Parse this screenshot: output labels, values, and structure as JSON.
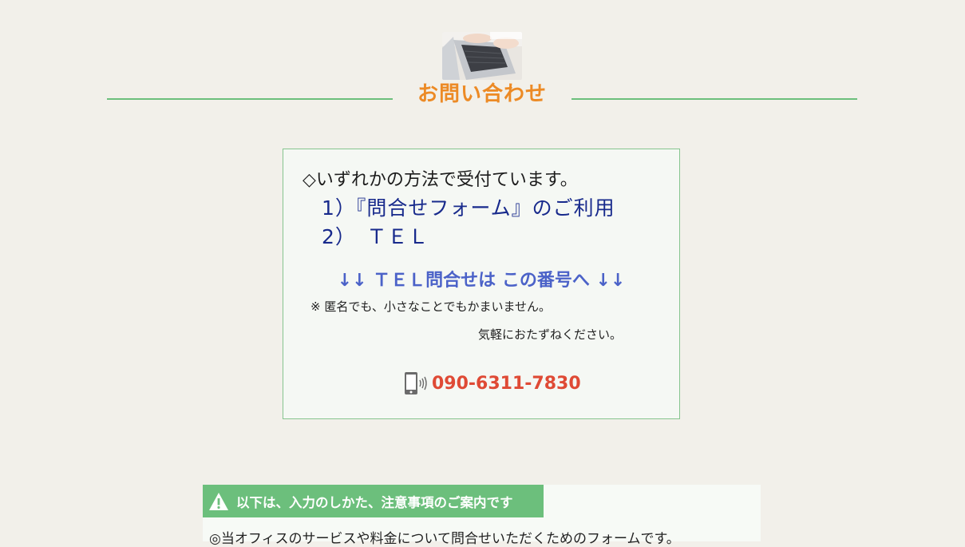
{
  "header": {
    "title": "お問い合わせ",
    "image_name": "laptop-typing-photo"
  },
  "contact_box": {
    "intro": "◇いずれかの方法で受付ています。",
    "options": [
      "1）『問合せフォーム』のご利用",
      "2）　ＴＥＬ"
    ],
    "tel_heading": "↓↓ ＴＥＬ問合せは この番号へ ↓↓",
    "note_line1": "※ 匿名でも、小さなことでもかまいません。",
    "note_line2": "気軽におたずねください。",
    "phone_icon": "smartphone-icon",
    "phone_number": "090-6311-7830"
  },
  "notice": {
    "icon": "warning-icon",
    "text": "以下は、入力のしかた、注意事項のご案内です",
    "description": "◎当オフィスのサービスや料金について問合せいただくためのフォームです。"
  },
  "colors": {
    "background": "#f2f0ea",
    "accent_orange": "#ec8a25",
    "rule_green": "#6cbf7c",
    "navy": "#182a8c",
    "tel_blue": "#4b62c8",
    "phone_red": "#df4a35"
  }
}
